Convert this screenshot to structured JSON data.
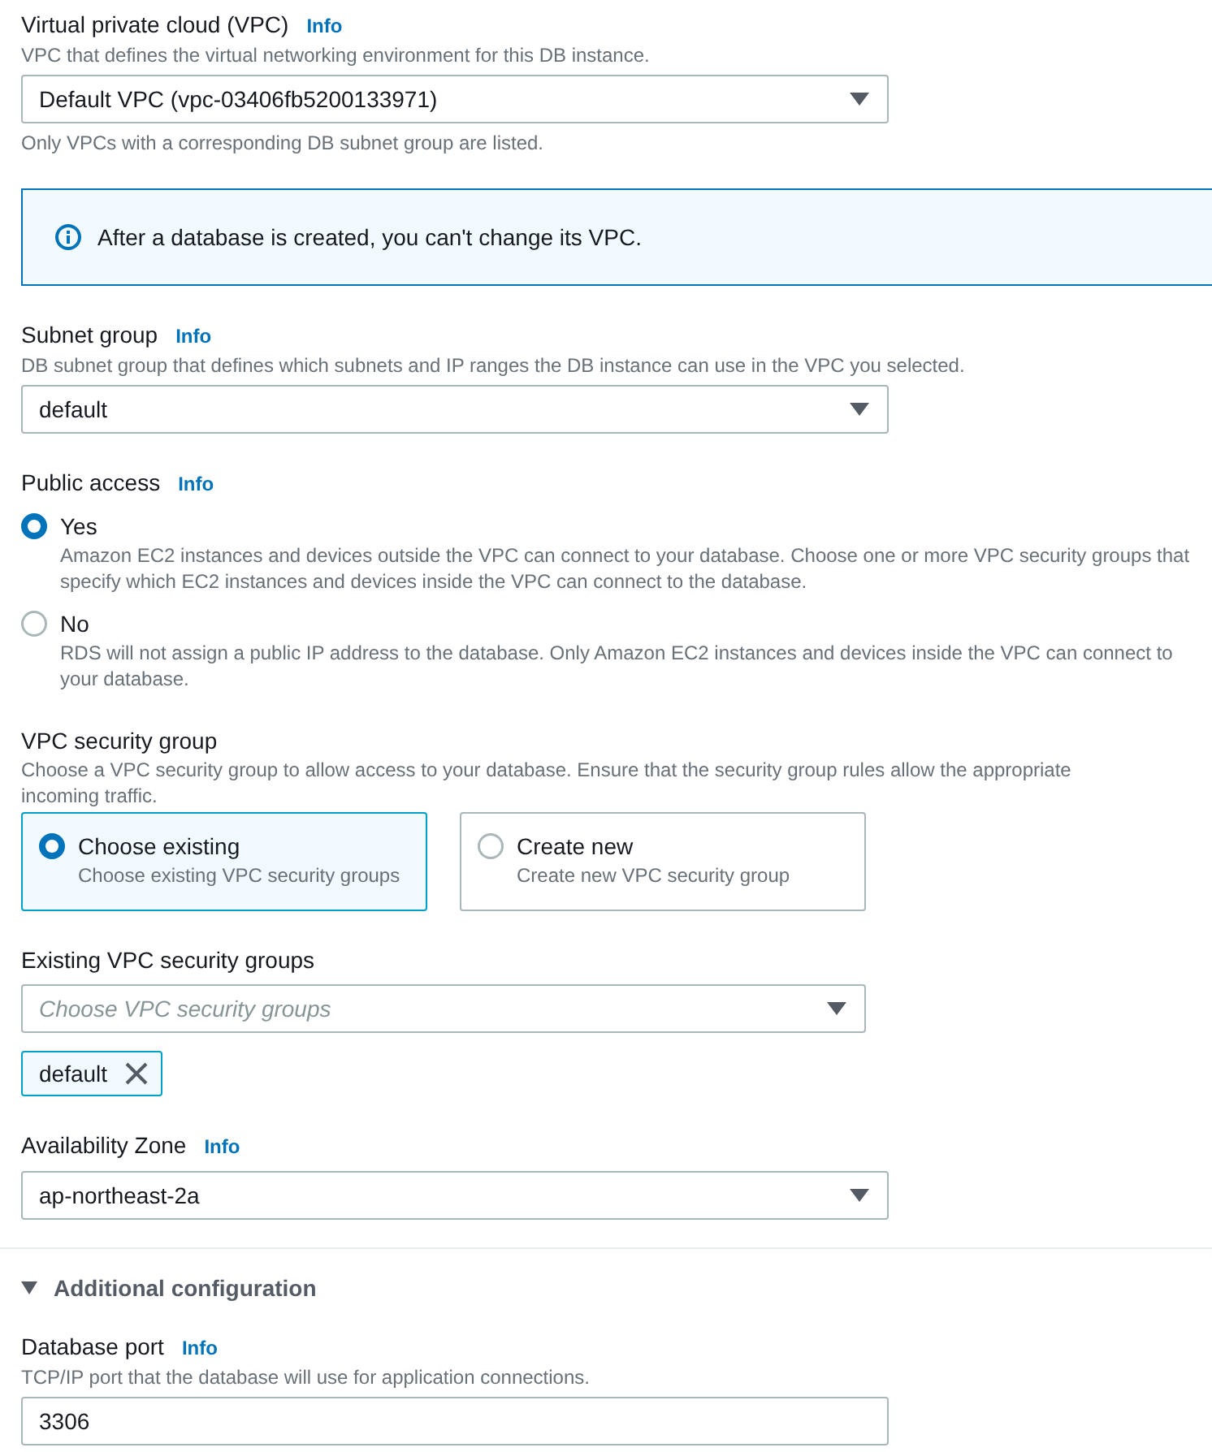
{
  "fields": [
    {
      "kind": "select",
      "label": "Virtual private cloud (VPC)",
      "info": "Info",
      "description": "VPC that defines the virtual networking environment for this DB instance.",
      "value": "Default VPC (vpc-03406fb5200133971)",
      "hint": "Only VPCs with a corresponding DB subnet group are listed."
    },
    {
      "kind": "alert",
      "text": "After a database is created, you can't change its VPC."
    },
    {
      "kind": "select",
      "label": "Subnet group",
      "info": "Info",
      "description": "DB subnet group that defines which subnets and IP ranges the DB instance can use in the VPC you selected.",
      "value": "default"
    },
    {
      "kind": "radio",
      "label": "Public access",
      "info": "Info",
      "options": [
        {
          "label": "Yes",
          "description": "Amazon EC2 instances and devices outside the VPC can connect to your database. Choose one or more VPC security groups that specify which EC2 instances and devices inside the VPC can connect to the database.",
          "selected": true
        },
        {
          "label": "No",
          "description": "RDS will not assign a public IP address to the database. Only Amazon EC2 instances and devices inside the VPC can connect to your database.",
          "selected": false
        }
      ]
    },
    {
      "kind": "tiles",
      "label": "VPC security group",
      "description": "Choose a VPC security group to allow access to your database. Ensure that the security group rules allow the appropriate incoming traffic.",
      "options": [
        {
          "label": "Choose existing",
          "description": "Choose existing VPC security groups",
          "selected": true
        },
        {
          "label": "Create new",
          "description": "Create new VPC security group",
          "selected": false
        }
      ]
    },
    {
      "kind": "multiselect",
      "label": "Existing VPC security groups",
      "placeholder": "Choose VPC security groups",
      "tokens": [
        {
          "label": "default"
        }
      ]
    },
    {
      "kind": "select",
      "label": "Availability Zone",
      "info": "Info",
      "value": "ap-northeast-2a"
    },
    {
      "kind": "expander",
      "title": "Additional configuration",
      "expanded": true,
      "fields": [
        {
          "kind": "input",
          "label": "Database port",
          "info": "Info",
          "description": "TCP/IP port that the database will use for application connections.",
          "value": "3306"
        }
      ]
    }
  ]
}
